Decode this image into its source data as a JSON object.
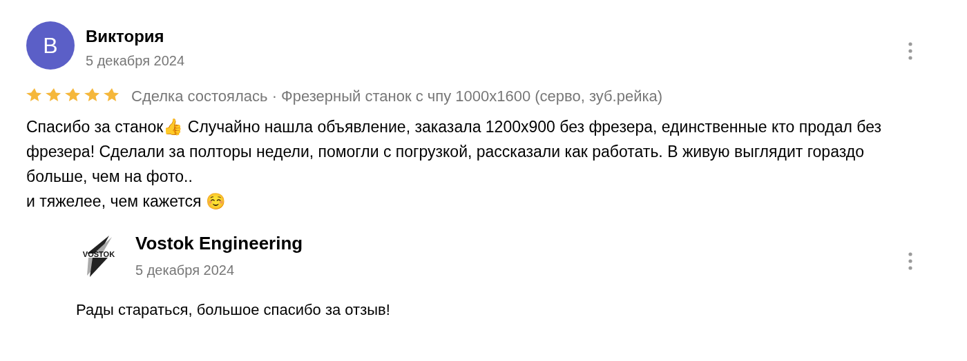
{
  "review": {
    "avatar_letter": "B",
    "author": "Виктория",
    "date": "5 декабря 2024",
    "stars": 5,
    "deal": "Сделка состоялась · Фрезерный станок с чпу 1000x1600 (серво, зуб.рейка)",
    "text_lines": [
      "Спасибо за станок👍 Случайно нашла объявление, заказала 1200x900 без фрезера, единственные кто продал без фрезера! Сделали за полторы недели, помогли с погрузкой, рассказали как работать. В живую выглядит гораздо больше, чем на фото..",
      "и тяжелее, чем кажется ☺️"
    ]
  },
  "reply": {
    "logo_text": "VOSTOK",
    "author": "Vostok Engineering",
    "date": "5 декабря 2024",
    "text": "Рады стараться, большое спасибо за отзыв!"
  }
}
